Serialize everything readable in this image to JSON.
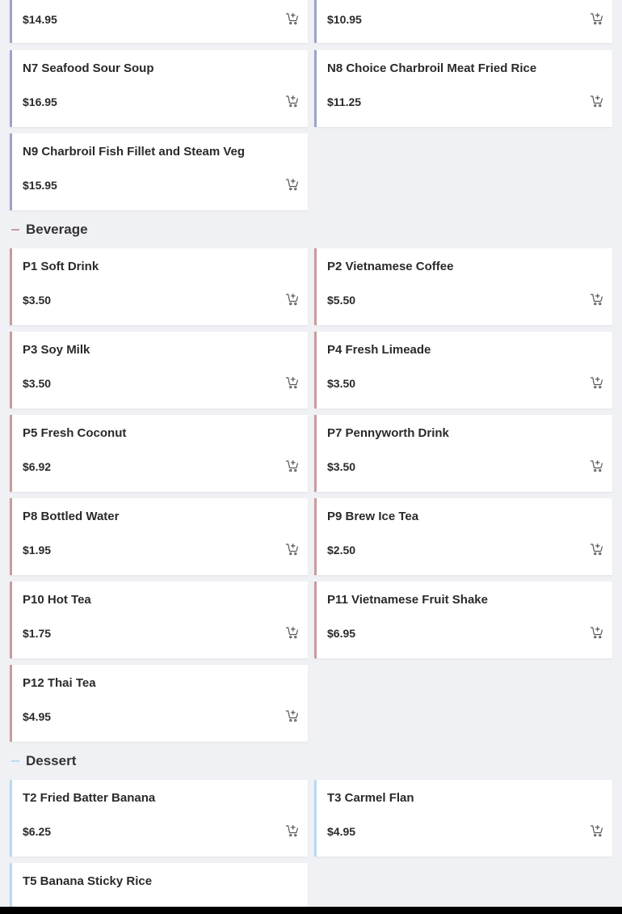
{
  "colors": {
    "background": "#f0f1f5",
    "card": "#ffffff",
    "accent_noodle": "#9aa4cc",
    "accent_beverage": "#c99b9b",
    "accent_dessert": "#b9daef",
    "bottom_bar": "#000000"
  },
  "icons": {
    "add_to_cart": "cart-plus-icon",
    "collapse": "minus-icon"
  },
  "top_items": [
    {
      "price": "$14.95"
    },
    {
      "price": "$10.95"
    }
  ],
  "noodle_items": [
    {
      "name": "N7 Seafood Sour Soup",
      "price": "$16.95"
    },
    {
      "name": "N8 Choice Charbroil Meat Fried Rice",
      "price": "$11.25"
    },
    {
      "name": "N9 Charbroil Fish Fillet and Steam Veg",
      "price": "$15.95"
    }
  ],
  "beverage": {
    "title": "Beverage",
    "items": [
      {
        "name": "P1 Soft Drink",
        "price": "$3.50"
      },
      {
        "name": "P2 Vietnamese Coffee",
        "price": "$5.50"
      },
      {
        "name": "P3 Soy Milk",
        "price": "$3.50"
      },
      {
        "name": "P4 Fresh Limeade",
        "price": "$3.50"
      },
      {
        "name": "P5 Fresh Coconut",
        "price": "$6.92"
      },
      {
        "name": "P7 Pennyworth Drink",
        "price": "$3.50"
      },
      {
        "name": "P8 Bottled Water",
        "price": "$1.95"
      },
      {
        "name": "P9 Brew Ice Tea",
        "price": "$2.50"
      },
      {
        "name": "P10 Hot Tea",
        "price": "$1.75"
      },
      {
        "name": "P11 Vietnamese Fruit Shake",
        "price": "$6.95"
      },
      {
        "name": "P12 Thai Tea",
        "price": "$4.95"
      }
    ]
  },
  "dessert": {
    "title": "Dessert",
    "items": [
      {
        "name": "T2 Fried Batter Banana",
        "price": "$6.25"
      },
      {
        "name": "T3 Carmel Flan",
        "price": "$4.95"
      },
      {
        "name": "T5 Banana Sticky Rice",
        "price": ""
      }
    ]
  }
}
